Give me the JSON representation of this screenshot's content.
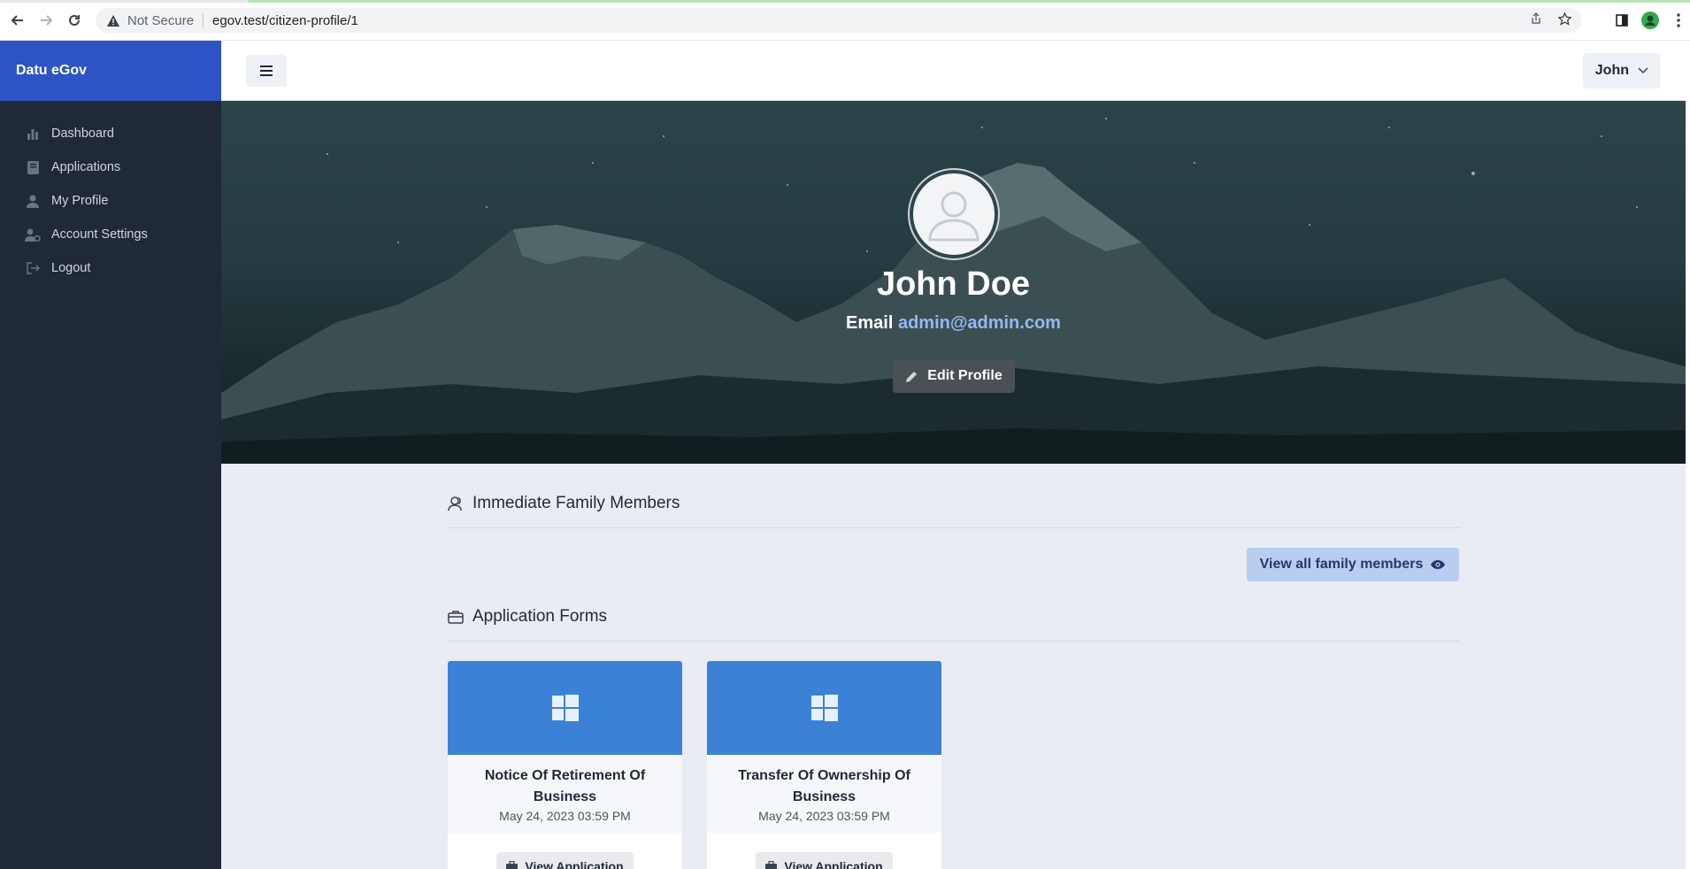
{
  "browser": {
    "security_label": "Not Secure",
    "url": "egov.test/citizen-profile/1"
  },
  "sidebar": {
    "brand": "Datu eGov",
    "items": [
      {
        "label": "Dashboard",
        "icon": "chart-bar-icon"
      },
      {
        "label": "Applications",
        "icon": "book-icon"
      },
      {
        "label": "My Profile",
        "icon": "user-icon"
      },
      {
        "label": "Account Settings",
        "icon": "user-gear-icon"
      },
      {
        "label": "Logout",
        "icon": "logout-icon"
      }
    ]
  },
  "topbar": {
    "user_name": "John"
  },
  "profile": {
    "name": "John Doe",
    "email_label": "Email",
    "email": "admin@admin.com",
    "edit_label": "Edit Profile"
  },
  "family": {
    "title": "Immediate Family Members",
    "view_all_label": "View all family members"
  },
  "forms": {
    "title": "Application Forms",
    "cards": [
      {
        "title": "Notice Of Retirement Of Business",
        "date": "May 24, 2023 03:59 PM",
        "button": "View Application"
      },
      {
        "title": "Transfer Of Ownership Of Business",
        "date": "May 24, 2023 03:59 PM",
        "button": "View Application"
      }
    ]
  },
  "colors": {
    "brand": "#2c54c4",
    "sidebar_bg": "#1f2937",
    "card_header": "#3b82d6",
    "link": "#93b8f4"
  }
}
